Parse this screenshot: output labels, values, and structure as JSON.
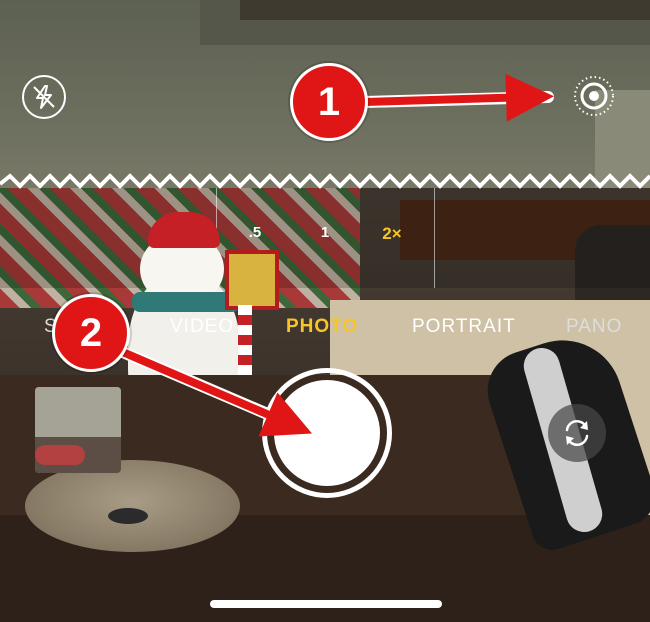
{
  "camera": {
    "flash_icon": "flash-off-icon",
    "live_icon": "live-photo-icon",
    "zoom_levels": [
      ".5",
      "1",
      "2×"
    ],
    "active_zoom": "2×",
    "modes": [
      "S",
      "VIDEO",
      "PHOTO",
      "PORTRAIT",
      "PANO"
    ],
    "active_mode": "PHOTO",
    "flip_icon": "camera-flip-icon"
  },
  "annotations": {
    "badge_1": "1",
    "badge_2": "2"
  },
  "colors": {
    "accent_yellow": "#f7c52a",
    "annotation_red": "#e01616"
  }
}
